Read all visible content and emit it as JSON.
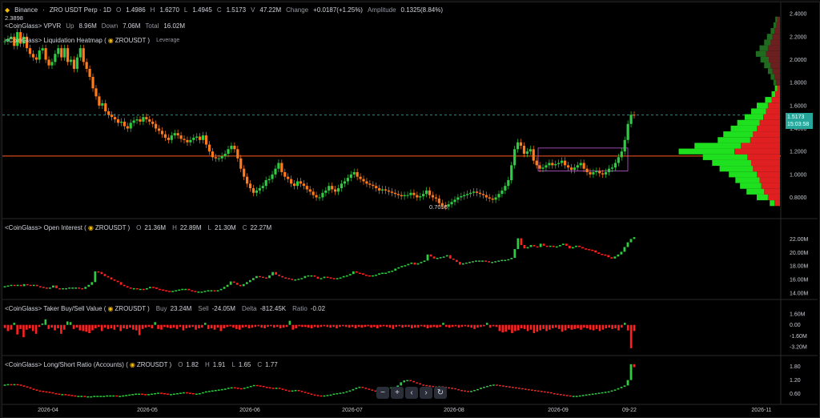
{
  "symbol_header": {
    "exchange": "Binance",
    "title": "ZRO USDT Perp · 1D",
    "o_label": "O",
    "o": "1.4986",
    "h_label": "H",
    "h": "1.6270",
    "l_label": "L",
    "l": "1.4945",
    "c_label": "C",
    "c": "1.5173",
    "v_label": "V",
    "v": "47.22M",
    "change_label": "Change",
    "change": "+0.0187(+1.25%)",
    "amp_label": "Amplitude",
    "amp": "0.1325(8.84%)"
  },
  "high_marker": "2.3898",
  "low_marker": "0.7056",
  "vpvr": {
    "name": "<CoinGlass> VPVR",
    "up_label": "Up",
    "up": "8.96M",
    "down_label": "Down",
    "down": "7.06M",
    "total_label": "Total",
    "total": "16.02M"
  },
  "heatmap": {
    "name": "<CoinGlass> Liquidation Heatmap (",
    "pair": "ZROUSDT",
    "close": ")",
    "leverage": "Leverage"
  },
  "price_tag": {
    "price": "1.5173",
    "countdown": "15:03:58"
  },
  "open_interest": {
    "name": "<CoinGlass> Open Interest (",
    "pair": "ZROUSDT",
    "close": ")",
    "o_label": "O",
    "o": "21.36M",
    "h_label": "H",
    "h": "22.89M",
    "l_label": "L",
    "l": "21.30M",
    "c_label": "C",
    "c": "22.27M"
  },
  "taker": {
    "name": "<CoinGlass> Taker Buy/Sell Value (",
    "pair": "ZROUSDT",
    "close": ")",
    "buy_label": "Buy",
    "buy": "23.24M",
    "sell_label": "Sell",
    "sell": "-24.05M",
    "delta_label": "Delta",
    "delta": "-812.45K",
    "ratio_label": "Ratio",
    "ratio": "-0.02"
  },
  "long_short": {
    "name": "<CoinGlass> Long/Short Ratio (Accounts) (",
    "pair": "ZROUSDT",
    "close": ")",
    "o_label": "O",
    "o": "1.82",
    "h_label": "H",
    "h": "1.91",
    "l_label": "L",
    "l": "1.65",
    "c_label": "C",
    "c": "1.77"
  },
  "toolbar": {
    "minus": "−",
    "plus": "+",
    "left": "‹",
    "right": "›",
    "reset": "↻"
  },
  "colors": {
    "up": "#2ecc40",
    "down": "#ff2020",
    "vol_up": "#1fe01f",
    "vol_down": "#e02020",
    "price_line": "#26a69a",
    "liq_line": "#ff5a1f",
    "candle_orange": "#ff7a1a",
    "candle_green": "#2ecc40"
  },
  "chart_data": [
    {
      "type": "candlestick",
      "title": "ZRO USDT Perp · 1D",
      "x_ticks": [
        "2026-04",
        "2026-05",
        "2026-06",
        "2026-07",
        "2026-08",
        "2026-09",
        "09-22",
        "2026-11"
      ],
      "y_ticks": [
        "2.4000",
        "2.2000",
        "2.0000",
        "1.8000",
        "1.6000",
        "1.4000",
        "1.2000",
        "1.0000",
        "0.8000"
      ],
      "ylim": [
        0.65,
        2.45
      ],
      "close_series": [
        2.16,
        2.18,
        2.2,
        2.12,
        2.24,
        2.14,
        2.2,
        2.1,
        2.05,
        2.02,
        2.0,
        2.08,
        2.1,
        2.0,
        1.95,
        1.98,
        2.05,
        2.1,
        2.02,
        2.1,
        1.98,
        2.0,
        1.92,
        2.02,
        2.1,
        1.98,
        1.92,
        1.85,
        1.75,
        1.68,
        1.6,
        1.62,
        1.55,
        1.52,
        1.5,
        1.48,
        1.45,
        1.46,
        1.42,
        1.4,
        1.45,
        1.47,
        1.48,
        1.46,
        1.5,
        1.48,
        1.46,
        1.44,
        1.4,
        1.38,
        1.35,
        1.32,
        1.3,
        1.34,
        1.36,
        1.34,
        1.31,
        1.3,
        1.28,
        1.3,
        1.32,
        1.33,
        1.3,
        1.34,
        1.26,
        1.2,
        1.15,
        1.14,
        1.14,
        1.16,
        1.18,
        1.22,
        1.25,
        1.22,
        1.14,
        1.05,
        0.98,
        0.92,
        0.88,
        0.84,
        0.86,
        0.88,
        0.9,
        0.95,
        0.96,
        1.0,
        1.05,
        1.1,
        1.02,
        0.98,
        0.96,
        0.92,
        0.9,
        0.94,
        0.92,
        0.9,
        0.87,
        0.85,
        0.82,
        0.8,
        0.8,
        0.84,
        0.86,
        0.9,
        0.87,
        0.85,
        0.88,
        0.92,
        0.94,
        0.97,
        1.0,
        1.02,
        0.98,
        0.96,
        0.94,
        0.92,
        0.91,
        0.9,
        0.88,
        0.86,
        0.87,
        0.86,
        0.85,
        0.84,
        0.83,
        0.82,
        0.81,
        0.82,
        0.82,
        0.84,
        0.82,
        0.8,
        0.81,
        0.83,
        0.86,
        0.82,
        0.8,
        0.79,
        0.75,
        0.73,
        0.72,
        0.74,
        0.76,
        0.78,
        0.8,
        0.81,
        0.82,
        0.83,
        0.84,
        0.85,
        0.84,
        0.83,
        0.82,
        0.8,
        0.79,
        0.78,
        0.8,
        0.83,
        0.86,
        0.9,
        0.95,
        1.08,
        1.22,
        1.28,
        1.25,
        1.18,
        1.2,
        1.22,
        1.12,
        1.08,
        1.05,
        1.06,
        1.08,
        1.1,
        1.08,
        1.09,
        1.1,
        1.12,
        1.08,
        1.06,
        1.04,
        1.06,
        1.08,
        1.1,
        1.05,
        1.02,
        1.0,
        1.02,
        1.03,
        1.01,
        1.0,
        1.02,
        1.05,
        1.06,
        1.1,
        1.15,
        1.2,
        1.3,
        1.44,
        1.52,
        1.5173
      ]
    },
    {
      "type": "bar",
      "title": "<CoinGlass> Open Interest",
      "y_ticks": [
        "22.00M",
        "20.00M",
        "18.00M",
        "16.00M",
        "14.00M"
      ],
      "ylim": [
        13.5,
        23.0
      ],
      "values": [
        15.0,
        15.1,
        15.2,
        15.1,
        15.2,
        15.0,
        15.3,
        15.2,
        15.1,
        15.2,
        15.0,
        14.9,
        14.8,
        14.7,
        14.8,
        15.1,
        14.7,
        14.6,
        14.7,
        14.7,
        14.8,
        14.8,
        14.8,
        14.7,
        14.6,
        14.9,
        15.2,
        15.6,
        17.2,
        17.1,
        16.8,
        16.5,
        16.3,
        16.0,
        15.8,
        15.6,
        15.2,
        15.0,
        14.8,
        14.7,
        14.7,
        14.6,
        14.6,
        14.5,
        14.7,
        14.9,
        14.8,
        14.6,
        14.5,
        14.4,
        14.3,
        14.2,
        14.3,
        14.4,
        14.5,
        14.6,
        14.6,
        14.4,
        14.3,
        14.2,
        14.2,
        14.2,
        14.3,
        14.4,
        14.4,
        14.3,
        14.4,
        14.6,
        14.9,
        15.2,
        15.7,
        15.5,
        15.2,
        15.0,
        15.3,
        15.6,
        15.9,
        16.2,
        16.5,
        16.4,
        16.3,
        16.2,
        16.6,
        17.1,
        16.7,
        16.5,
        16.3,
        16.2,
        16.1,
        16.0,
        16.0,
        16.1,
        16.2,
        16.5,
        16.6,
        16.6,
        16.4,
        16.1,
        16.2,
        16.4,
        16.3,
        16.2,
        16.1,
        16.2,
        16.3,
        16.5,
        16.6,
        16.8,
        17.2,
        17.0,
        16.9,
        16.7,
        16.6,
        16.5,
        16.6,
        16.7,
        16.9,
        17.0,
        17.0,
        17.2,
        17.3,
        17.6,
        17.8,
        18.0,
        18.1,
        18.3,
        18.5,
        18.2,
        18.4,
        18.6,
        18.8,
        19.7,
        19.4,
        19.1,
        19.2,
        19.3,
        19.4,
        19.6,
        19.1,
        18.9,
        18.6,
        18.2,
        18.4,
        18.5,
        18.6,
        18.7,
        18.8,
        18.8,
        18.8,
        18.7,
        18.6,
        18.6,
        18.7,
        18.8,
        18.9,
        18.9,
        19.0,
        19.2,
        20.5,
        22.1,
        21.1,
        20.6,
        20.8,
        21.1,
        20.9,
        20.8,
        21.3,
        21.0,
        20.9,
        21.0,
        20.8,
        20.9,
        21.1,
        21.3,
        21.0,
        20.6,
        20.8,
        21.0,
        20.8,
        20.6,
        20.5,
        20.4,
        20.3,
        20.0,
        19.8,
        19.7,
        19.6,
        19.3,
        19.1,
        19.4,
        19.7,
        20.1,
        20.8,
        21.5,
        22.0,
        22.27
      ]
    },
    {
      "type": "bar",
      "title": "<CoinGlass> Taker Buy/Sell Value",
      "y_ticks": [
        "1.60M",
        "0.00",
        "-1.60M",
        "-3.20M"
      ],
      "ylim": [
        -4.0,
        2.3
      ],
      "values": [
        -0.45,
        -0.9,
        -0.7,
        0.3,
        -1.4,
        -0.6,
        -1.8,
        -0.7,
        -0.5,
        -0.9,
        -1.3,
        -0.3,
        0.2,
        0.8,
        -0.6,
        -0.4,
        -0.8,
        -0.5,
        -1.3,
        -0.7,
        0.5,
        0.4,
        -0.6,
        -0.4,
        -0.8,
        -0.9,
        -1.0,
        -1.2,
        -0.8,
        -0.5,
        -0.3,
        -0.9,
        -0.4,
        -0.6,
        -0.5,
        -0.7,
        -0.3,
        -0.9,
        -0.5,
        -0.6,
        -0.4,
        -0.7,
        -0.8,
        -1.5,
        -0.6,
        -0.4,
        -0.3,
        -0.5,
        0.4,
        -0.6,
        -0.7,
        -0.3,
        -0.4,
        -0.5,
        -0.4,
        -0.6,
        -0.3,
        -0.8,
        -0.5,
        -0.4,
        -0.3,
        -0.7,
        -0.5,
        -0.4,
        0.3,
        -0.6,
        -0.5,
        -0.7,
        -0.4,
        -0.9,
        -0.5,
        -0.3,
        -0.2,
        -0.4,
        -0.6,
        -0.7,
        -0.4,
        -0.3,
        -0.5,
        -0.4,
        -0.3,
        -0.2,
        -0.4,
        -0.5,
        -0.3,
        -0.2,
        -0.4,
        -0.3,
        -0.5,
        -0.4,
        -0.3,
        0.6,
        -0.7,
        -0.5,
        -0.2,
        -0.3,
        -0.3,
        -0.4,
        -0.5,
        -0.3,
        -0.4,
        -0.3,
        -0.2,
        -0.3,
        -0.4,
        -0.3,
        -0.5,
        -0.3,
        -0.2,
        -0.3,
        -0.4,
        -0.3,
        -0.5,
        -0.3,
        -0.4,
        -0.3,
        -0.2,
        -0.4,
        -0.3,
        -0.5,
        -0.3,
        -0.2,
        -0.3,
        -0.4,
        -0.6,
        -0.3,
        -0.2,
        -0.4,
        -0.3,
        -0.3,
        -0.5,
        -0.4,
        -0.4,
        -0.2,
        -0.3,
        -0.5,
        -0.4,
        -0.3,
        -0.4,
        -0.3,
        0.3,
        -0.3,
        -0.4,
        -0.3,
        -0.2,
        -0.4,
        -0.3,
        -0.2,
        -0.3,
        -0.4,
        -0.6,
        -0.4,
        -0.3,
        -0.2,
        0.3,
        -0.4,
        -0.2,
        -0.3,
        -0.9,
        -1.1,
        -1.0,
        -0.7,
        -1.2,
        -0.9,
        -0.8,
        -0.5,
        -0.6,
        -0.9,
        -0.7,
        -1.2,
        -1.0,
        -0.8,
        -0.6,
        -0.9,
        -0.7,
        -0.5,
        -0.4,
        -0.6,
        -1.0,
        -0.8,
        -0.5,
        -0.7,
        -0.6,
        -0.5,
        -0.7,
        -0.4,
        -0.5,
        -0.7,
        -0.8,
        -0.6,
        -0.9,
        -0.7,
        -0.5,
        -0.4,
        -0.6,
        -0.5,
        -0.8,
        -0.4,
        0.3,
        -0.812,
        -3.4,
        -0.9
      ]
    },
    {
      "type": "bar",
      "title": "<CoinGlass> Long/Short Ratio (Accounts)",
      "y_ticks": [
        "1.80",
        "1.20",
        "0.60"
      ],
      "ylim": [
        0.3,
        2.0
      ],
      "values": [
        1.0,
        1.02,
        1.0,
        1.02,
        1.0,
        0.96,
        0.92,
        0.88,
        0.82,
        0.78,
        0.74,
        0.72,
        0.7,
        0.68,
        0.66,
        0.62,
        0.6,
        0.58,
        0.58,
        0.56,
        0.54,
        0.52,
        0.5,
        0.5,
        0.5,
        0.48,
        0.48,
        0.48,
        0.5,
        0.5,
        0.5,
        0.5,
        0.52,
        0.52,
        0.52,
        0.5,
        0.5,
        0.52,
        0.54,
        0.56,
        0.58,
        0.6,
        0.6,
        0.58,
        0.56,
        0.58,
        0.6,
        0.62,
        0.64,
        0.62,
        0.6,
        0.58,
        0.58,
        0.6,
        0.62,
        0.64,
        0.66,
        0.64,
        0.62,
        0.6,
        0.6,
        0.62,
        0.66,
        0.7,
        0.72,
        0.74,
        0.76,
        0.78,
        0.8,
        0.82,
        0.86,
        0.88,
        0.86,
        0.84,
        0.82,
        0.86,
        0.9,
        0.94,
        0.98,
        0.96,
        0.94,
        0.9,
        0.88,
        0.86,
        0.84,
        0.86,
        0.82,
        0.78,
        0.74,
        0.72,
        0.74,
        0.76,
        0.72,
        0.68,
        0.64,
        0.6,
        0.56,
        0.54,
        0.52,
        0.5,
        0.52,
        0.54,
        0.56,
        0.6,
        0.62,
        0.64,
        0.66,
        0.7,
        0.74,
        0.8,
        0.86,
        0.9,
        0.86,
        0.82,
        0.78,
        0.74,
        0.72,
        0.76,
        0.78,
        0.82,
        0.84,
        0.88,
        0.9,
        0.96,
        1.1,
        1.18,
        1.2,
        1.16,
        1.1,
        1.06,
        1.0,
        0.98,
        0.96,
        0.94,
        0.92,
        0.9,
        0.92,
        0.9,
        0.88,
        0.86,
        0.84,
        0.8,
        0.76,
        0.74,
        0.72,
        0.7,
        0.72,
        0.76,
        0.8,
        0.86,
        0.9,
        0.94,
        0.98,
        1.0,
        0.98,
        0.96,
        0.94,
        0.92,
        0.9,
        0.88,
        0.86,
        0.84,
        0.82,
        0.8,
        0.78,
        0.76,
        0.74,
        0.72,
        0.7,
        0.68,
        0.66,
        0.62,
        0.6,
        0.58,
        0.56,
        0.54,
        0.52,
        0.5,
        0.5,
        0.5,
        0.52,
        0.54,
        0.56,
        0.58,
        0.6,
        0.62,
        0.64,
        0.66,
        0.68,
        0.7,
        0.74,
        0.78,
        0.84,
        0.9,
        0.96,
        1.2,
        1.9,
        1.77
      ]
    },
    {
      "type": "bar",
      "title": "<CoinGlass> VPVR",
      "note": "volume-by-price histogram, price levels ascending",
      "price_levels": [
        0.75,
        0.8,
        0.85,
        0.9,
        0.95,
        1.0,
        1.05,
        1.1,
        1.15,
        1.2,
        1.25,
        1.3,
        1.35,
        1.4,
        1.45,
        1.5,
        1.55,
        1.6,
        1.65,
        1.7,
        1.75,
        1.8,
        1.85,
        1.9,
        1.95,
        2.0,
        2.05,
        2.1,
        2.15,
        2.2,
        2.25,
        2.3,
        2.35
      ],
      "series": [
        {
          "name": "Up",
          "values": [
            10,
            24,
            38,
            46,
            52,
            60,
            72,
            84,
            96,
            120,
            100,
            70,
            64,
            56,
            48,
            40,
            32,
            24,
            14,
            8,
            5,
            6,
            8,
            10,
            14,
            18,
            22,
            18,
            14,
            12,
            8,
            6,
            4
          ]
        },
        {
          "name": "Down",
          "values": [
            12,
            26,
            34,
            40,
            44,
            50,
            58,
            62,
            70,
            98,
            84,
            64,
            58,
            50,
            44,
            36,
            30,
            26,
            18,
            10,
            6,
            8,
            12,
            16,
            20,
            24,
            30,
            26,
            20,
            16,
            12,
            8,
            6
          ]
        }
      ]
    }
  ]
}
